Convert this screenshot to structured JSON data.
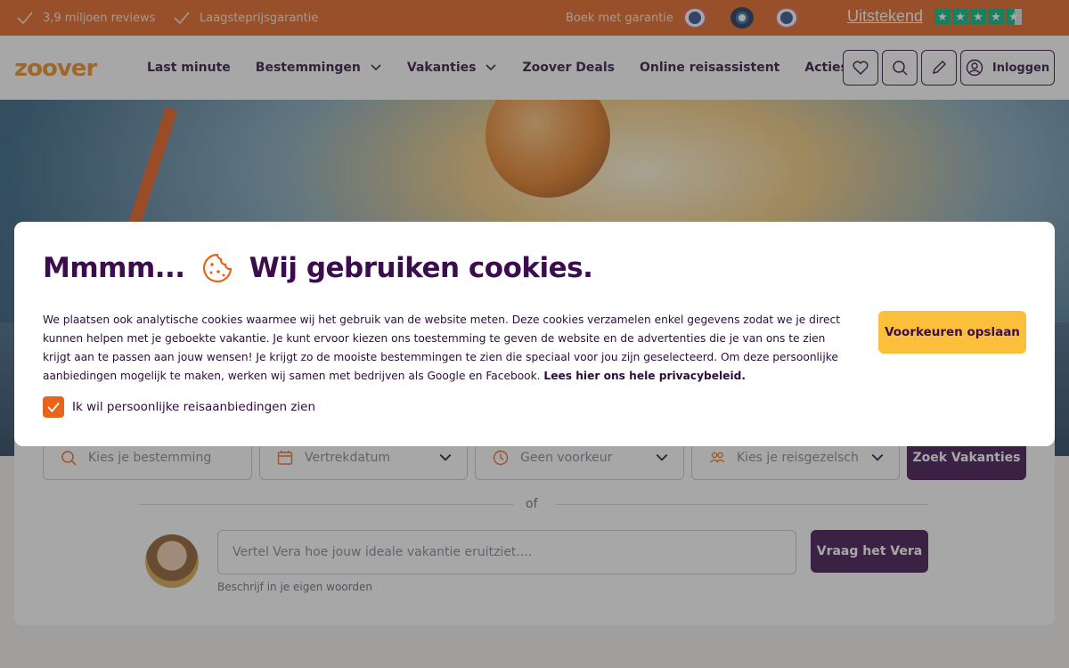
{
  "topbar": {
    "usp1": "3,9 miljoen reviews",
    "usp2": "Laagsteprijsgarantie",
    "garantie": "Boek met garantie",
    "rating_label": "Uitstekend",
    "rating_stars": 4.5
  },
  "header": {
    "logo": "zoover",
    "nav": [
      "Last minute",
      "Bestemmingen",
      "Vakanties",
      "Zoover Deals",
      "Online reisassistent",
      "Acties"
    ],
    "login_label": "Inloggen"
  },
  "search": {
    "destination_placeholder": "Kies je bestemming",
    "date_placeholder": "Vertrekdatum",
    "duration_value": "Geen voorkeur",
    "party_placeholder": "Kies je reisgezelschap",
    "submit_label": "Zoek Vakanties",
    "or_label": "of",
    "vera_placeholder": "Vertel Vera hoe jouw ideale vakantie eruitziet....",
    "vera_button": "Vraag het Vera",
    "vera_hint": "Beschrijf in je eigen woorden"
  },
  "cookie": {
    "title_left": "Mmmm...",
    "title_right": "Wij gebruiken cookies.",
    "body": "We plaatsen ook analytische cookies waarmee wij het gebruik van de website meten. Deze cookies verzamelen enkel gegevens zodat we je direct kunnen helpen met je geboekte vakantie. Je kunt ervoor kiezen ons toestemming te geven de website en de advertenties die je van ons te zien krijgt aan te passen aan jouw wensen! Je krijgt zo de mooiste bestemmingen te zien die speciaal voor jou zijn geselecteerd. Om deze persoonlijke aanbiedingen mogelijk te maken, werken wij samen met bedrijven als Google en Facebook.",
    "privacy_link": "Lees hier ons hele privacybeleid.",
    "checkbox_label": "Ik wil persoonlijke reisaanbiedingen zien",
    "checkbox_checked": true,
    "save_button": "Voorkeuren opslaan"
  },
  "colors": {
    "brand_orange": "#e2621b",
    "brand_purple": "#3b0d4e",
    "accent_yellow": "#fbbf3c",
    "trustpilot_green": "#00b67a"
  }
}
